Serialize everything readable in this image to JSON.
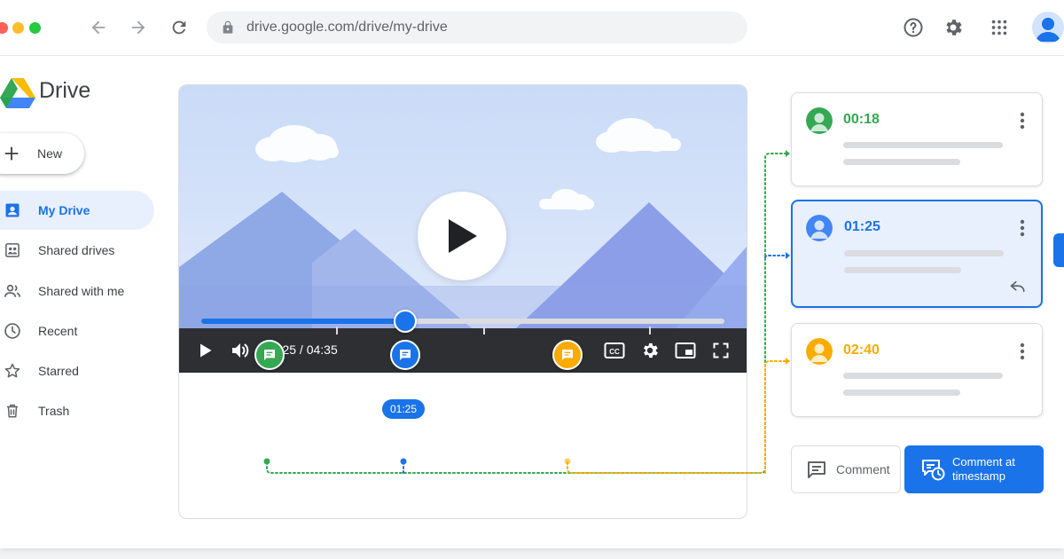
{
  "browser": {
    "url": "drive.google.com/drive/my-drive"
  },
  "app": {
    "brand": "Drive"
  },
  "sidebar": {
    "new_label": "New",
    "items": [
      {
        "label": "My Drive",
        "icon": "my-drive-icon",
        "active": true
      },
      {
        "label": "Shared drives",
        "icon": "shared-drives-icon"
      },
      {
        "label": "Shared with me",
        "icon": "shared-with-me-icon"
      },
      {
        "label": "Recent",
        "icon": "clock-icon"
      },
      {
        "label": "Starred",
        "icon": "star-icon"
      },
      {
        "label": "Trash",
        "icon": "trash-icon"
      }
    ]
  },
  "player": {
    "current_time": "01:25",
    "duration": "04:35",
    "time_display": "01:25 / 04:35",
    "progress": 0.39,
    "timeline_pill": "01:25",
    "markers": [
      {
        "time": "00:18",
        "color": "#34a853",
        "position": 0.13
      },
      {
        "time": "01:25",
        "color": "#1a73e8",
        "position": 0.39
      },
      {
        "time": "02:40",
        "color": "#f9ab00",
        "position": 0.7
      }
    ]
  },
  "comments": [
    {
      "timestamp": "00:18",
      "color": "#34a853",
      "active": false
    },
    {
      "timestamp": "01:25",
      "color": "#1a73e8",
      "active": true
    },
    {
      "timestamp": "02:40",
      "color": "#f9ab00",
      "active": false
    }
  ],
  "actions": {
    "comment_label": "Comment",
    "comment_at_timestamp_label": "Comment at timestamp"
  },
  "colors": {
    "accent": "#1a73e8",
    "green": "#34a853",
    "yellow": "#f9ab00",
    "control_bar": "#2d2f33"
  }
}
